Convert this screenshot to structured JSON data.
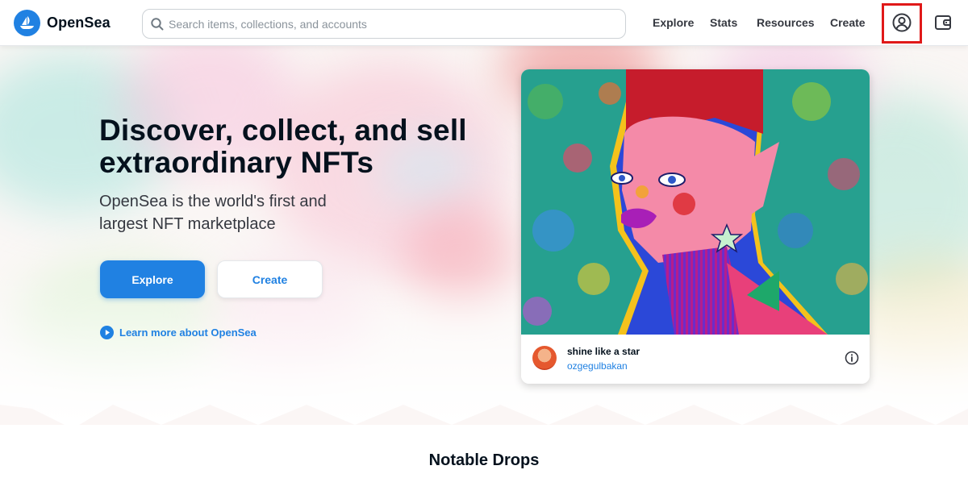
{
  "header": {
    "logo_text": "OpenSea",
    "search_placeholder": "Search items, collections, and accounts",
    "nav": [
      "Explore",
      "Stats",
      "Resources",
      "Create"
    ]
  },
  "hero": {
    "title": "Discover, collect, and sell extraordinary NFTs",
    "subtitle": "OpenSea is the world's first and largest NFT marketplace",
    "explore_button": "Explore",
    "create_button": "Create",
    "learn_more": "Learn more about OpenSea"
  },
  "featured": {
    "name": "shine like a star",
    "creator": "ozgegulbakan"
  },
  "sections": {
    "notable_drops": "Notable Drops"
  },
  "colors": {
    "brand": "#2081e2",
    "highlight": "#e01919"
  },
  "icons": [
    "search-icon",
    "profile-icon",
    "wallet-icon",
    "play-circle-icon",
    "info-icon"
  ]
}
